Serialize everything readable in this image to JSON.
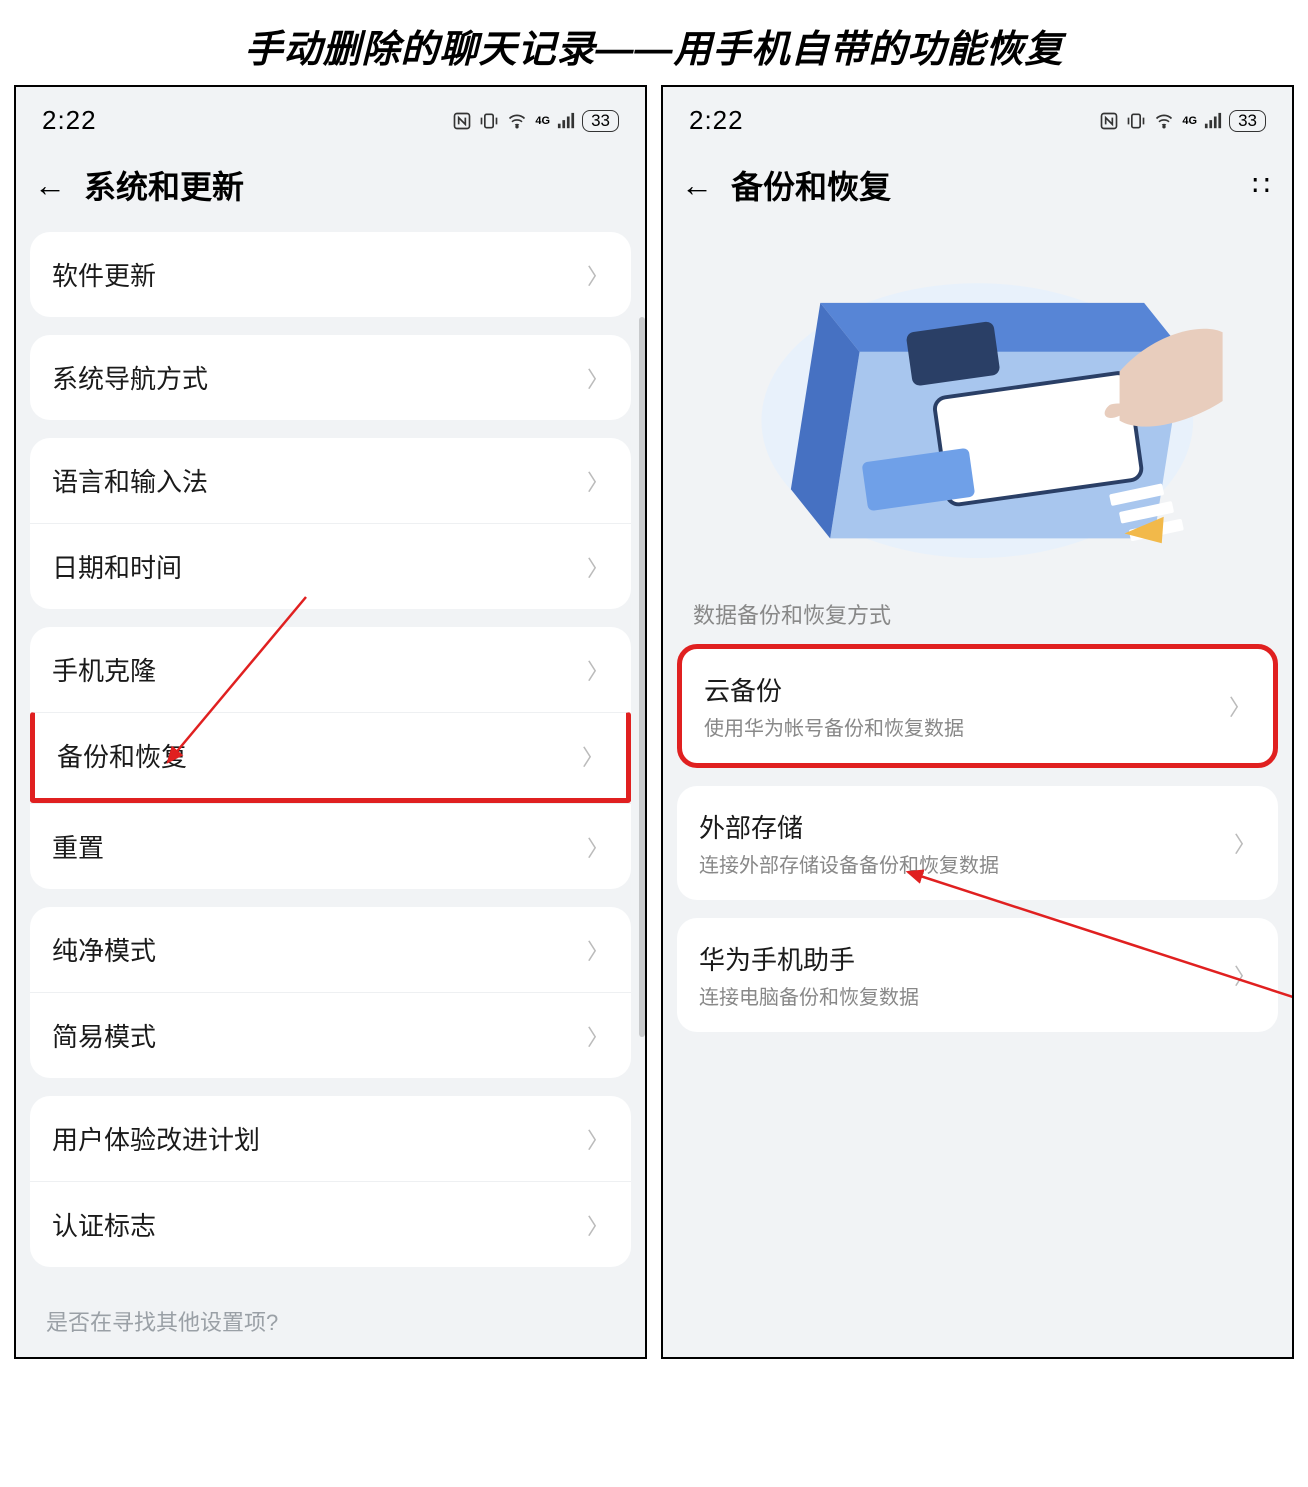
{
  "title": "手动删除的聊天记录——用手机自带的功能恢复",
  "status": {
    "time": "2:22",
    "battery": "33"
  },
  "left": {
    "header": "系统和更新",
    "groups": [
      {
        "items": [
          {
            "label": "软件更新"
          }
        ]
      },
      {
        "items": [
          {
            "label": "系统导航方式"
          }
        ]
      },
      {
        "items": [
          {
            "label": "语言和输入法"
          },
          {
            "label": "日期和时间"
          }
        ]
      },
      {
        "items": [
          {
            "label": "手机克隆"
          },
          {
            "label": "备份和恢复"
          },
          {
            "label": "重置"
          }
        ]
      },
      {
        "items": [
          {
            "label": "纯净模式"
          },
          {
            "label": "简易模式"
          }
        ]
      },
      {
        "items": [
          {
            "label": "用户体验改进计划"
          },
          {
            "label": "认证标志"
          }
        ]
      }
    ],
    "bottom_hint": "是否在寻找其他设置项?"
  },
  "right": {
    "header": "备份和恢复",
    "section_label": "数据备份和恢复方式",
    "items": [
      {
        "label": "云备份",
        "sub": "使用华为帐号备份和恢复数据"
      },
      {
        "label": "外部存储",
        "sub": "连接外部存储设备备份和恢复数据"
      },
      {
        "label": "华为手机助手",
        "sub": "连接电脑备份和恢复数据"
      }
    ]
  }
}
